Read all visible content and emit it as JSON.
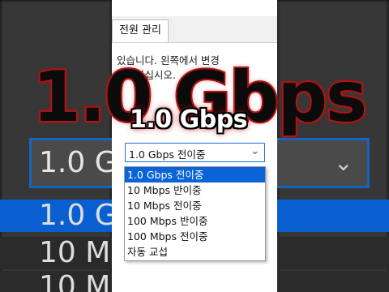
{
  "tab": {
    "label": "전원 관리"
  },
  "description": {
    "line1": "있습니다. 왼쪽에서 변경",
    "line2": "선택하십시오."
  },
  "select": {
    "value": "1.0 Gbps 전이중"
  },
  "options": [
    {
      "label": "1.0 Gbps 전이중",
      "selected": true
    },
    {
      "label": "10 Mbps 반이중",
      "selected": false
    },
    {
      "label": "10 Mbps 전이중",
      "selected": false
    },
    {
      "label": "100 Mbps 반이중",
      "selected": false
    },
    {
      "label": "100 Mbps 전이중",
      "selected": false
    },
    {
      "label": "자동 교섭",
      "selected": false
    }
  ],
  "overlay": {
    "big_text": "1.0 Gbps",
    "small_text": "1.0 Gbps"
  },
  "colors": {
    "accent": "#0a64d8",
    "caption_glow": "#c01818"
  },
  "background": {
    "box_text": "1.0 Gb",
    "rows": [
      "1.0 Gb",
      "10 Mb",
      "10 Mb"
    ]
  }
}
